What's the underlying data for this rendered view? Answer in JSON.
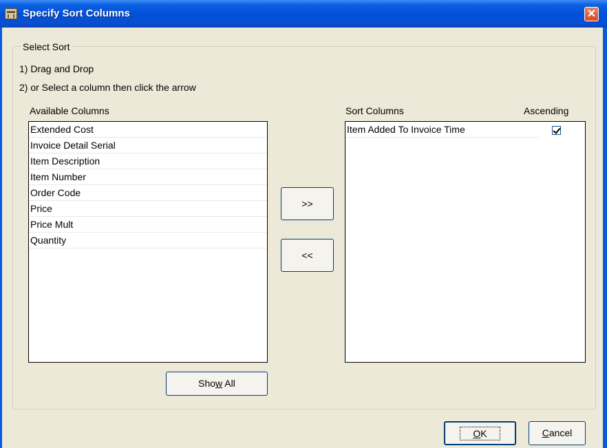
{
  "window": {
    "title": "Specify Sort Columns",
    "close_glyph": "✕"
  },
  "group": {
    "legend": "Select Sort"
  },
  "instructions": [
    "1) Drag and Drop",
    "2) or Select a column then click the arrow"
  ],
  "available": {
    "label": "Available Columns",
    "items": [
      "Extended Cost",
      "Invoice Detail Serial",
      "Item Description",
      "Item Number",
      "Order Code",
      "Price",
      "Price Mult",
      "Quantity"
    ]
  },
  "sort": {
    "label": "Sort Columns",
    "ascending_label": "Ascending",
    "items": [
      {
        "name": "Item Added To Invoice Time",
        "ascending": true
      }
    ]
  },
  "buttons": {
    "add": ">>",
    "remove": "<<",
    "show_all_pre": "Sho",
    "show_all_mn": "w",
    "show_all_post": " All",
    "ok_mn": "O",
    "ok_post": "K",
    "cancel_mn": "C",
    "cancel_post": "ancel"
  }
}
